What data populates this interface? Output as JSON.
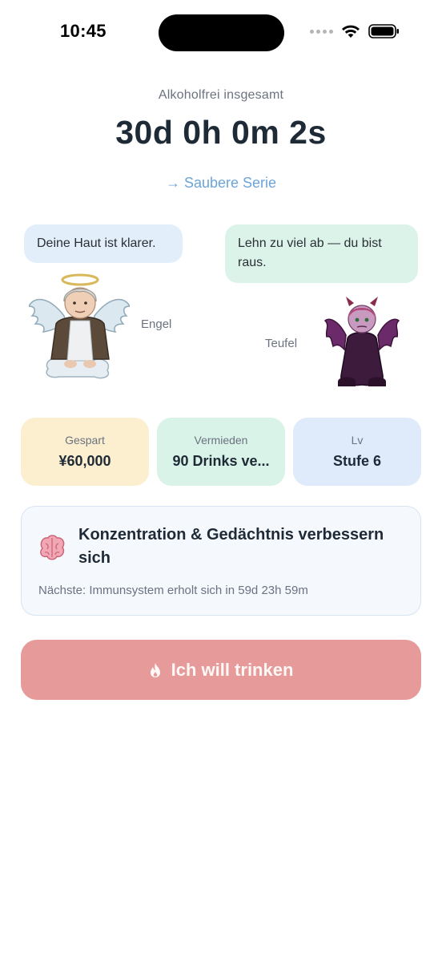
{
  "status_bar": {
    "time": "10:45"
  },
  "header": {
    "total_label": "Alkoholfrei insgesamt",
    "timer": "30d 0h 0m 2s",
    "streak_link": "→ Saubere Serie"
  },
  "characters": {
    "angel": {
      "name": "Engel",
      "message": "Deine Haut ist klarer."
    },
    "devil": {
      "name": "Teufel",
      "message": "Lehn zu viel ab — du bist raus."
    }
  },
  "stats": [
    {
      "label": "Gespart",
      "value": "¥60,000",
      "color": "#fcefcf"
    },
    {
      "label": "Vermieden",
      "value": "90 Drinks ve...",
      "color": "#d9f3e8"
    },
    {
      "label": "Lv",
      "value": "Stufe 6",
      "color": "#dfeafa"
    }
  ],
  "milestone": {
    "icon": "brain-icon",
    "title": "Konzentration & Gedächtnis verbessern sich",
    "next": "Nächste: Immunsystem erholt sich in 59d 23h 59m"
  },
  "drink_button": {
    "label": "Ich will trinken",
    "icon": "fire-icon",
    "color": "#e69a99"
  }
}
